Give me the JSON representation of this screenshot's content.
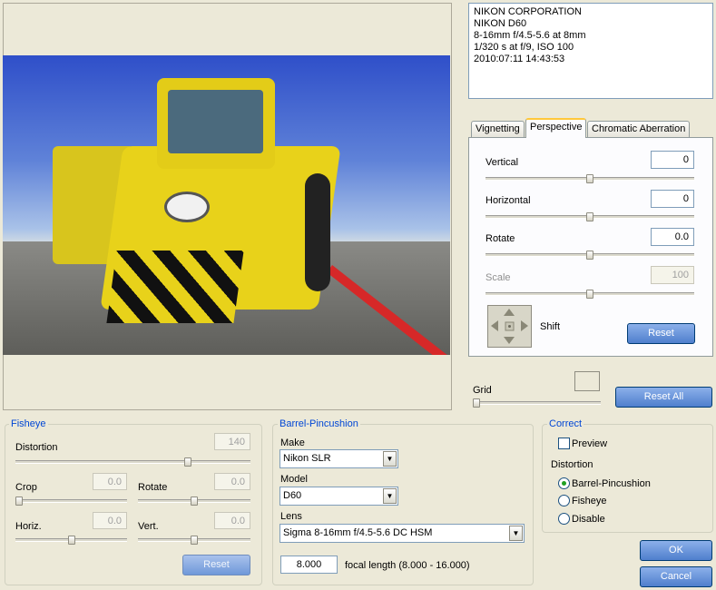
{
  "exif": {
    "line1": "NIKON CORPORATION",
    "line2": "NIKON D60",
    "line3": "8-16mm f/4.5-5.6 at 8mm",
    "line4": "1/320 s at f/9, ISO 100",
    "line5": "2010:07:11 14:43:53"
  },
  "tabs": {
    "vignetting": "Vignetting",
    "perspective": "Perspective",
    "chromatic": "Chromatic Aberration"
  },
  "perspective": {
    "vertical_label": "Vertical",
    "vertical_value": "0",
    "vertical_level": 0.5,
    "horizontal_label": "Horizontal",
    "horizontal_value": "0",
    "horizontal_level": 0.5,
    "rotate_label": "Rotate",
    "rotate_value": "0.0",
    "rotate_level": 0.5,
    "scale_label": "Scale",
    "scale_value": "100",
    "scale_level": 0.5,
    "shift_label": "Shift",
    "reset_label": "Reset"
  },
  "grid": {
    "label": "Grid",
    "level": 0.0,
    "reset_all_label": "Reset All"
  },
  "fisheye": {
    "title": "Fisheye",
    "distortion_label": "Distortion",
    "distortion_value": "140",
    "distortion_level": 0.74,
    "crop_label": "Crop",
    "crop_value": "0.0",
    "crop_level": 0.0,
    "rotate_label": "Rotate",
    "rotate_value": "0.0",
    "rotate_level": 0.5,
    "horiz_label": "Horiz.",
    "horiz_value": "0.0",
    "horiz_level": 0.5,
    "vert_label": "Vert.",
    "vert_value": "0.0",
    "vert_level": 0.5,
    "reset_label": "Reset"
  },
  "barrel": {
    "title": "Barrel-Pincushion",
    "make_label": "Make",
    "make_value": "Nikon SLR",
    "model_label": "Model",
    "model_value": "D60",
    "lens_label": "Lens",
    "lens_value": "Sigma 8-16mm f/4.5-5.6 DC HSM",
    "focal_value": "8.000",
    "focal_label": "focal length (8.000 - 16.000)"
  },
  "correct": {
    "title": "Correct",
    "preview_label": "Preview",
    "preview_checked": false,
    "distortion_label": "Distortion",
    "options": [
      "Barrel-Pincushion",
      "Fisheye",
      "Disable"
    ],
    "selected": "Barrel-Pincushion"
  },
  "dialog": {
    "ok_label": "OK",
    "cancel_label": "Cancel"
  },
  "colors": {
    "accent": "#4e7fd3",
    "group_title": "#0046d5",
    "tab_highlight": "#ffc83c"
  }
}
